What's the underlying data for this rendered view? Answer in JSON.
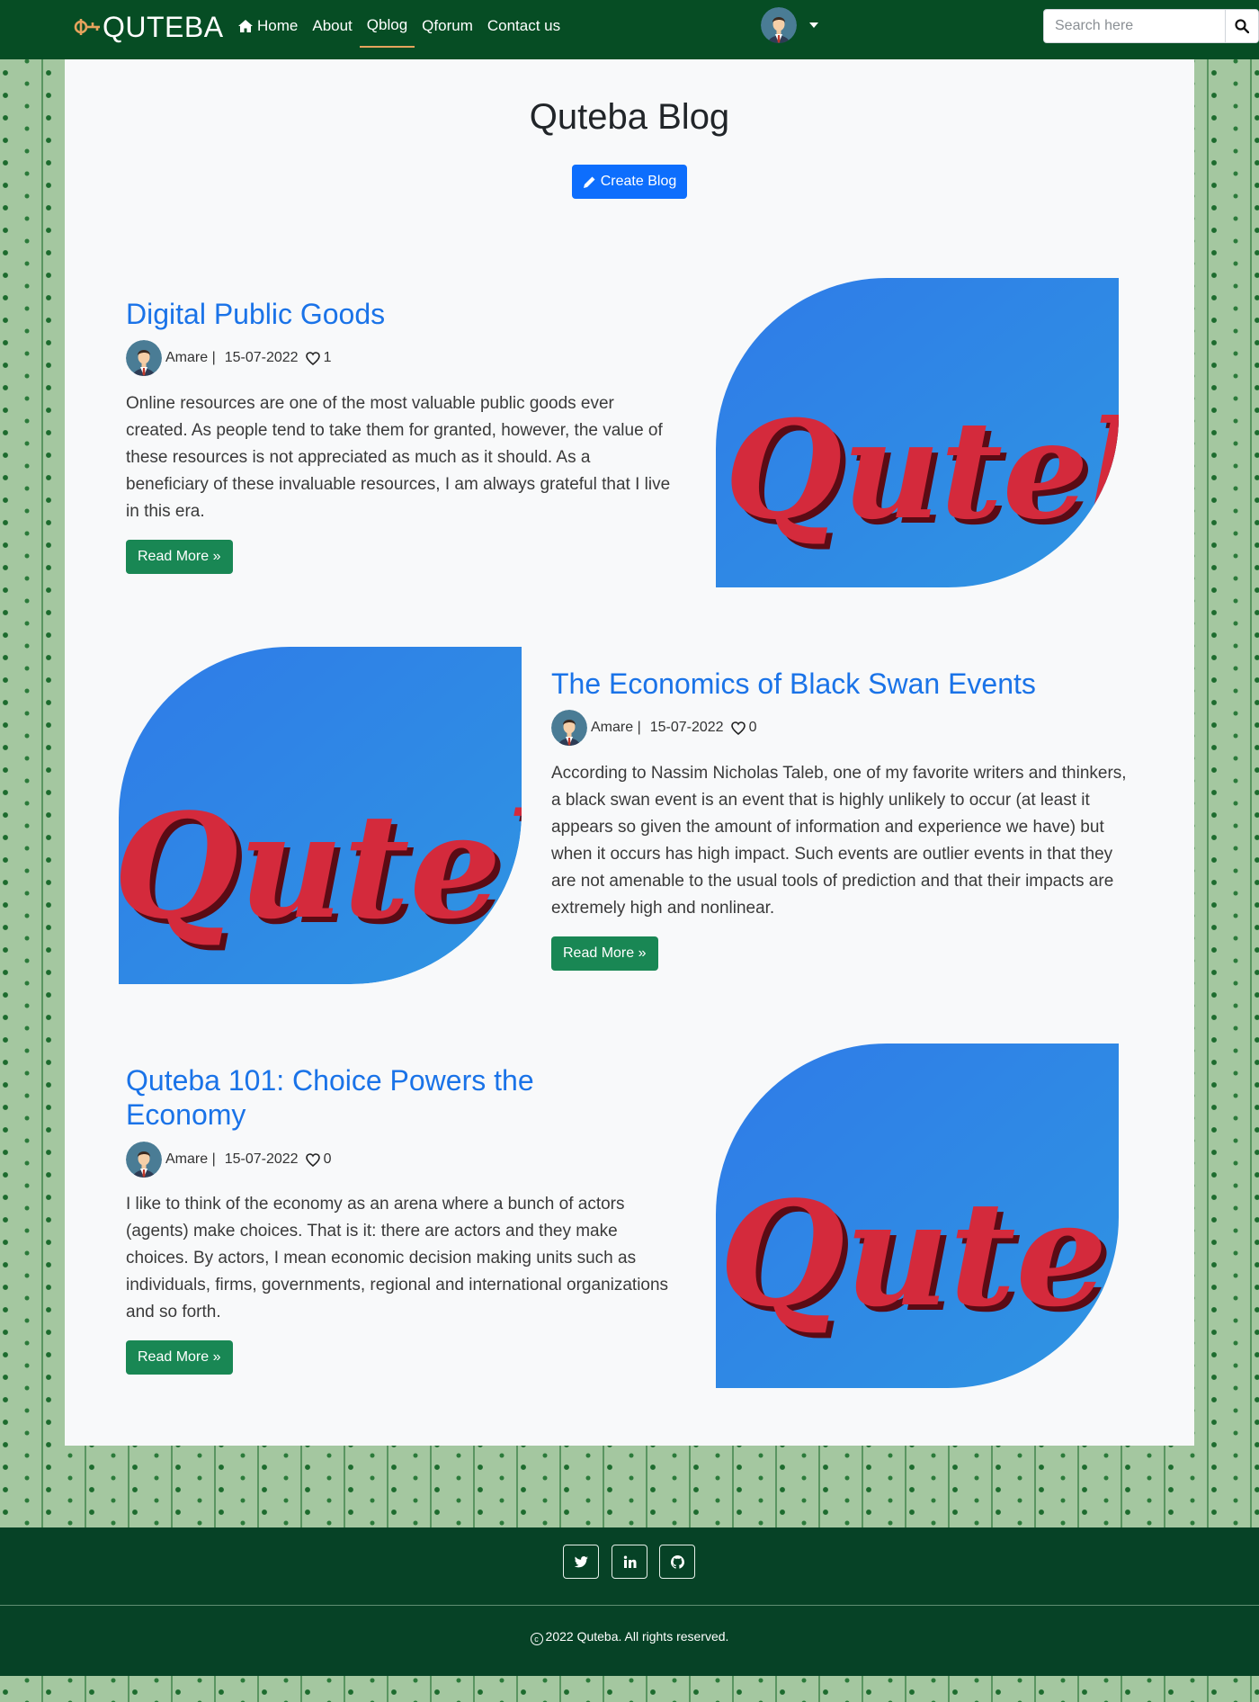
{
  "navbar": {
    "brand": "QUTEBA",
    "links": [
      {
        "label": "Home",
        "icon": "home-icon"
      },
      {
        "label": "About"
      },
      {
        "label": "Qblog",
        "active": true
      },
      {
        "label": "Qforum"
      },
      {
        "label": "Contact us"
      }
    ],
    "search_placeholder": "Search here"
  },
  "main": {
    "title": "Quteba Blog",
    "create_label": "Create Blog",
    "posts": [
      {
        "title": "Digital Public Goods",
        "author": "Amare |",
        "date": "15-07-2022",
        "likes": "1",
        "body": "Online resources are one of the most valuable public goods ever created. As people tend to take them for granted, however, the value of these resources is not appreciated as much as it should. As a beneficiary of these invaluable resources, I am always grateful that I live in this era.",
        "read_more": "Read More »",
        "image_text": "Quteba"
      },
      {
        "title": "The Economics of Black Swan Events",
        "author": "Amare |",
        "date": "15-07-2022",
        "likes": "0",
        "body": "According to Nassim Nicholas Taleb, one of my favorite writers and thinkers, a black swan event is an event that is highly unlikely to occur (at least it appears so given the amount of information and experience we have) but when it occurs has high impact. Such events are outlier events in that they are not amenable to the usual tools of prediction and that their impacts are extremely high and nonlinear.",
        "read_more": "Read More »",
        "image_text": "Quteba"
      },
      {
        "title": "Quteba 101: Choice Powers the Economy",
        "author": "Amare |",
        "date": "15-07-2022",
        "likes": "0",
        "body": "I like to think of the economy as an arena where a bunch of actors (agents) make choices. That is it: there are actors and they make choices. By actors, I mean economic decision making units such as individuals, firms, governments, regional and international organizations and so forth.",
        "read_more": "Read More »",
        "image_text": "Quteba"
      }
    ]
  },
  "footer": {
    "social": [
      "twitter-icon",
      "linkedin-icon",
      "github-icon"
    ],
    "copyright": "2022 Quteba. All rights reserved."
  },
  "colors": {
    "navbar": "#064d24",
    "link_active_underline": "#e5a35d",
    "post_title": "#1a73e8",
    "primary_button": "#0d6efd",
    "success_button": "#198754",
    "footer": "#064226"
  }
}
